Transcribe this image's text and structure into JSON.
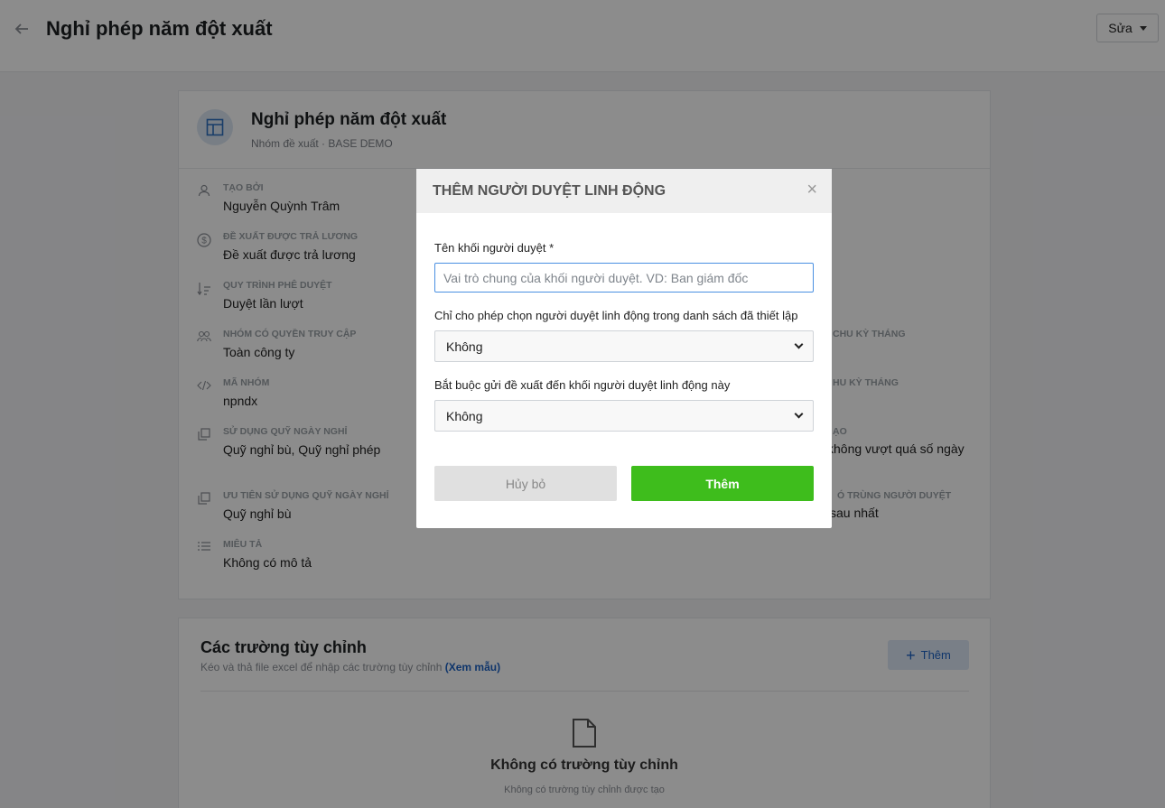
{
  "header": {
    "title": "Nghỉ phép năm đột xuất",
    "edit_label": "Sửa"
  },
  "card": {
    "title": "Nghỉ phép năm đột xuất",
    "subtitle": "Nhóm đề xuất · BASE DEMO",
    "fields": [
      {
        "label": "TẠO BỞI",
        "value": "Nguyễn Quỳnh Trâm",
        "icon": "user-icon"
      },
      {
        "label": "ĐỀ XUẤT ĐƯỢC TRẢ LƯƠNG",
        "value": "Đề xuất được trả lương",
        "icon": "dollar-icon"
      },
      {
        "label": "QUY TRÌNH PHÊ DUYỆT",
        "value": "Duyệt lần lượt",
        "icon": "sort-icon"
      },
      {
        "label": "NHÓM CÓ QUYỀN TRUY CẬP",
        "value": "Toàn công ty",
        "icon": "group-icon"
      },
      {
        "label": "MÃ NHÓM",
        "value": "npndx",
        "icon": "code-icon"
      },
      {
        "label": "SỬ DỤNG QUỸ NGÀY NGHỈ",
        "value": "Quỹ nghỉ bù, Quỹ nghỉ phép",
        "icon": "copy-icon"
      },
      {
        "label": "ƯU TIÊN SỬ DỤNG QUỸ NGÀY NGHỈ",
        "value": "Quỹ nghỉ bù",
        "icon": "copy-icon"
      },
      {
        "label": "MIÊU TẢ",
        "value": "Không có mô tả",
        "icon": "list-icon"
      }
    ],
    "right_fragments": [
      {
        "label": "CHU KỲ THÁNG",
        "value": ""
      },
      {
        "label": "HU KỲ THÁNG",
        "value": ""
      },
      {
        "label": "ẠO",
        "value": "không vượt quá số ngày"
      },
      {
        "label": "Ó TRÙNG NGƯỜI DUYỆT",
        "value": "sau nhất"
      }
    ]
  },
  "custom": {
    "title": "Các trường tùy chỉnh",
    "subtitle": "Kéo và thả file excel để nhập các trường tùy chỉnh",
    "sample_link": "(Xem mẫu)",
    "add_label": "Thêm",
    "empty_title": "Không có trường tùy chỉnh",
    "empty_sub": "Không có trường tùy chỉnh được tạo"
  },
  "modal": {
    "title": "THÊM NGƯỜI DUYỆT LINH ĐỘNG",
    "name_label": "Tên khối người duyệt *",
    "name_placeholder": "Vai trò chung của khối người duyệt. VD: Ban giám đốc",
    "restrict_label": "Chỉ cho phép chọn người duyệt linh động trong danh sách đã thiết lập",
    "restrict_value": "Không",
    "required_label": "Bắt buộc gửi đề xuất đến khối người duyệt linh động này",
    "required_value": "Không",
    "cancel_label": "Hủy bỏ",
    "submit_label": "Thêm"
  }
}
